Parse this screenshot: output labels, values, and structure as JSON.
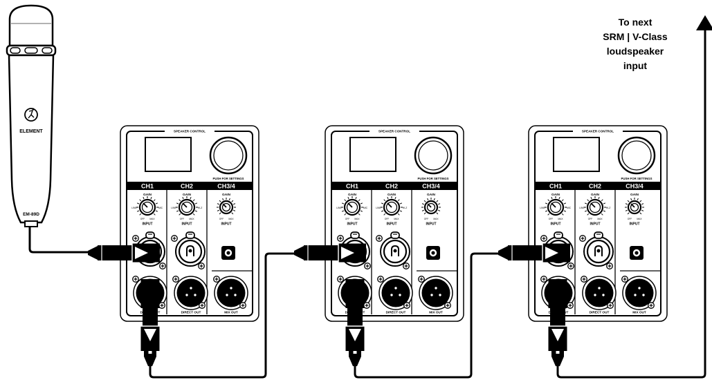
{
  "annotation": {
    "lines": [
      "To next",
      "SRM | V-Class",
      "loudspeaker",
      "input"
    ]
  },
  "microphone": {
    "brand": "ELEMENT",
    "model": "EM-89D",
    "logo_icon": "running-man-logo"
  },
  "panels": [
    {
      "header": "SPEAKER CONTROL",
      "knob_caption": "PUSH FOR SETTINGS",
      "channels": [
        "CH1",
        "CH2",
        "CH3/4"
      ],
      "gain_label": "GAIN",
      "input_label": "INPUT",
      "line_label": "LINE",
      "mic_label": "MIC",
      "hiz_label": "HI-Z",
      "off_label": "OFF",
      "max_label": "MAX",
      "direct_out_label": "DIRECT OUT",
      "mix_out_label": "MIX OUT"
    },
    {
      "header": "SPEAKER CONTROL",
      "knob_caption": "PUSH FOR SETTINGS",
      "channels": [
        "CH1",
        "CH2",
        "CH3/4"
      ],
      "gain_label": "GAIN",
      "input_label": "INPUT",
      "line_label": "LINE",
      "mic_label": "MIC",
      "hiz_label": "HI-Z",
      "off_label": "OFF",
      "max_label": "MAX",
      "direct_out_label": "DIRECT OUT",
      "mix_out_label": "MIX OUT"
    },
    {
      "header": "SPEAKER CONTROL",
      "knob_caption": "PUSH FOR SETTINGS",
      "channels": [
        "CH1",
        "CH2",
        "CH3/4"
      ],
      "gain_label": "GAIN",
      "input_label": "INPUT",
      "line_label": "LINE",
      "mic_label": "MIC",
      "hiz_label": "HI-Z",
      "off_label": "OFF",
      "max_label": "MAX",
      "direct_out_label": "DIRECT OUT",
      "mix_out_label": "MIX OUT"
    }
  ],
  "colors": {
    "ink": "#000000",
    "paper": "#ffffff",
    "panel_fill": "#ffffff"
  }
}
